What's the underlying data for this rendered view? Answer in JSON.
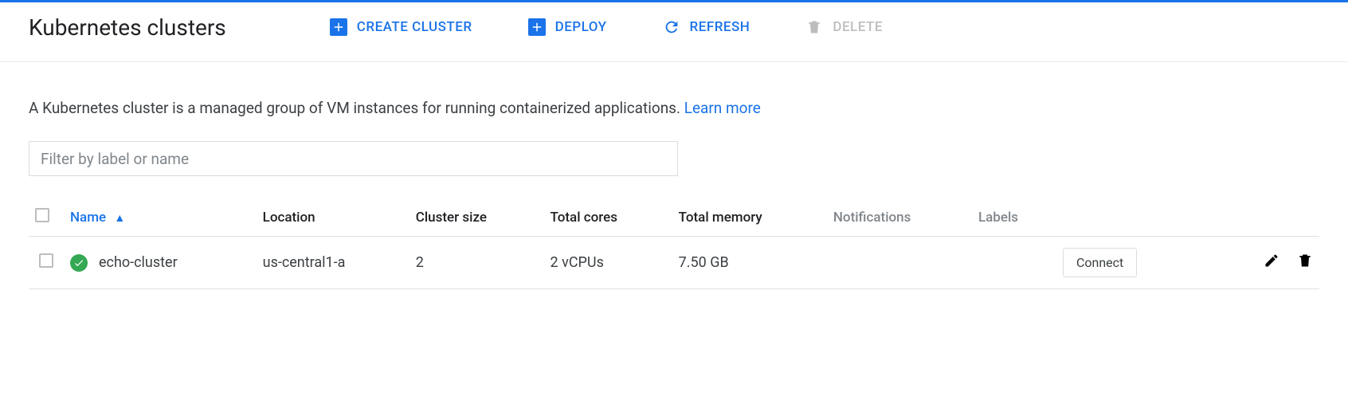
{
  "header": {
    "title": "Kubernetes clusters",
    "actions": {
      "create": "CREATE CLUSTER",
      "deploy": "DEPLOY",
      "refresh": "REFRESH",
      "delete": "DELETE"
    }
  },
  "description": {
    "text": "A Kubernetes cluster is a managed group of VM instances for running containerized applications. ",
    "learn_more": "Learn more"
  },
  "filter": {
    "placeholder": "Filter by label or name",
    "value": ""
  },
  "table": {
    "columns": {
      "name": "Name",
      "location": "Location",
      "cluster_size": "Cluster size",
      "total_cores": "Total cores",
      "total_memory": "Total memory",
      "notifications": "Notifications",
      "labels": "Labels"
    },
    "rows": [
      {
        "name": "echo-cluster",
        "location": "us-central1-a",
        "cluster_size": "2",
        "total_cores": "2 vCPUs",
        "total_memory": "7.50 GB",
        "notifications": "",
        "labels": "",
        "connect_label": "Connect"
      }
    ]
  }
}
